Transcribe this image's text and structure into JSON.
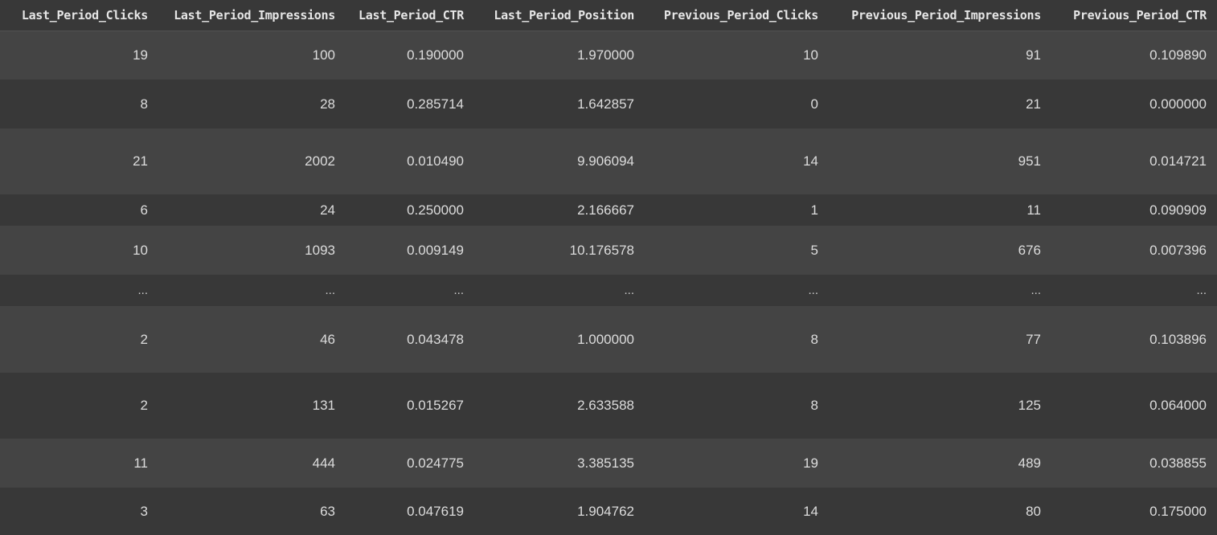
{
  "table": {
    "columns": [
      "Last_Period_Clicks",
      "Last_Period_Impressions",
      "Last_Period_CTR",
      "Last_Period_Position",
      "Previous_Period_Clicks",
      "Previous_Period_Impressions",
      "Previous_Period_CTR"
    ],
    "rows": [
      [
        "19",
        "100",
        "0.190000",
        "1.970000",
        "10",
        "91",
        "0.109890"
      ],
      [
        "8",
        "28",
        "0.285714",
        "1.642857",
        "0",
        "21",
        "0.000000"
      ],
      [
        "21",
        "2002",
        "0.010490",
        "9.906094",
        "14",
        "951",
        "0.014721"
      ],
      [
        "6",
        "24",
        "0.250000",
        "2.166667",
        "1",
        "11",
        "0.090909"
      ],
      [
        "10",
        "1093",
        "0.009149",
        "10.176578",
        "5",
        "676",
        "0.007396"
      ],
      [
        "...",
        "...",
        "...",
        "...",
        "...",
        "...",
        "..."
      ],
      [
        "2",
        "46",
        "0.043478",
        "1.000000",
        "8",
        "77",
        "0.103896"
      ],
      [
        "2",
        "131",
        "0.015267",
        "2.633588",
        "8",
        "125",
        "0.064000"
      ],
      [
        "11",
        "444",
        "0.024775",
        "3.385135",
        "19",
        "489",
        "0.038855"
      ],
      [
        "3",
        "63",
        "0.047619",
        "1.904762",
        "14",
        "80",
        "0.175000"
      ]
    ]
  },
  "colors": {
    "background": "#383838",
    "row_stripe": "#444444",
    "text": "#dcdcdc"
  }
}
